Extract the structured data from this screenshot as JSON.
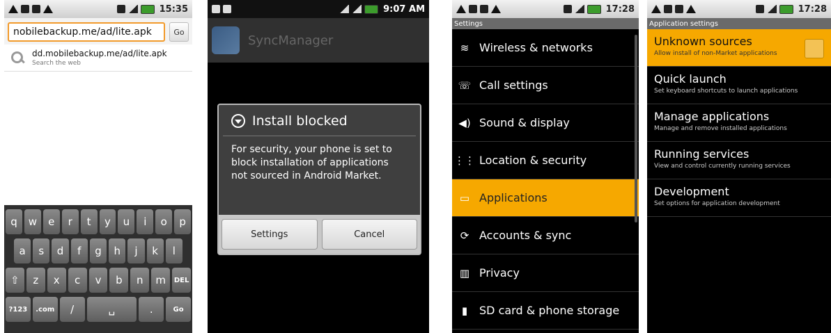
{
  "panel1": {
    "status": {
      "time": "15:35"
    },
    "url_value": "nobilebackup.me/ad/lite.apk",
    "go_label": "Go",
    "suggestion": {
      "main": "dd.mobilebackup.me/ad/lite.apk",
      "sub": "Search the web"
    },
    "keyboard": {
      "row1": [
        "q",
        "w",
        "e",
        "r",
        "t",
        "y",
        "u",
        "i",
        "o",
        "p"
      ],
      "row2": [
        "a",
        "s",
        "d",
        "f",
        "g",
        "h",
        "j",
        "k",
        "l"
      ],
      "row3": [
        "⇧",
        "z",
        "x",
        "c",
        "v",
        "b",
        "n",
        "m",
        "DEL"
      ],
      "row4": [
        "?123",
        ".com",
        "/",
        "␣",
        ".",
        "Go"
      ]
    }
  },
  "panel2": {
    "status": {
      "time": "9:07 AM"
    },
    "app_title": "SyncManager",
    "dialog": {
      "title": "Install blocked",
      "body": "For security, your phone is set to block installation of applications not sourced in Android Market.",
      "buttons": [
        "Settings",
        "Cancel"
      ]
    }
  },
  "panel3": {
    "status": {
      "time": "17:28"
    },
    "header": "Settings",
    "items": [
      {
        "label": "Wireless & networks",
        "icon": "wifi-icon",
        "glyph": "≋"
      },
      {
        "label": "Call settings",
        "icon": "phone-icon",
        "glyph": "☏"
      },
      {
        "label": "Sound & display",
        "icon": "speaker-icon",
        "glyph": "◀)"
      },
      {
        "label": "Location & security",
        "icon": "grid-icon",
        "glyph": "⋮⋮"
      },
      {
        "label": "Applications",
        "icon": "applications-icon",
        "glyph": "▭",
        "highlighted": true
      },
      {
        "label": "Accounts & sync",
        "icon": "sync-icon",
        "glyph": "⟳"
      },
      {
        "label": "Privacy",
        "icon": "privacy-icon",
        "glyph": "▥"
      },
      {
        "label": "SD card & phone storage",
        "icon": "sdcard-icon",
        "glyph": "▮"
      }
    ]
  },
  "panel4": {
    "status": {
      "time": "17:28"
    },
    "header": "Application settings",
    "items": [
      {
        "title": "Unknown sources",
        "sub": "Allow install of non-Market applications",
        "highlighted": true,
        "checkbox": true
      },
      {
        "title": "Quick launch",
        "sub": "Set keyboard shortcuts to launch applications"
      },
      {
        "title": "Manage applications",
        "sub": "Manage and remove installed applications"
      },
      {
        "title": "Running services",
        "sub": "View and control currently running services"
      },
      {
        "title": "Development",
        "sub": "Set options for application development"
      }
    ]
  }
}
